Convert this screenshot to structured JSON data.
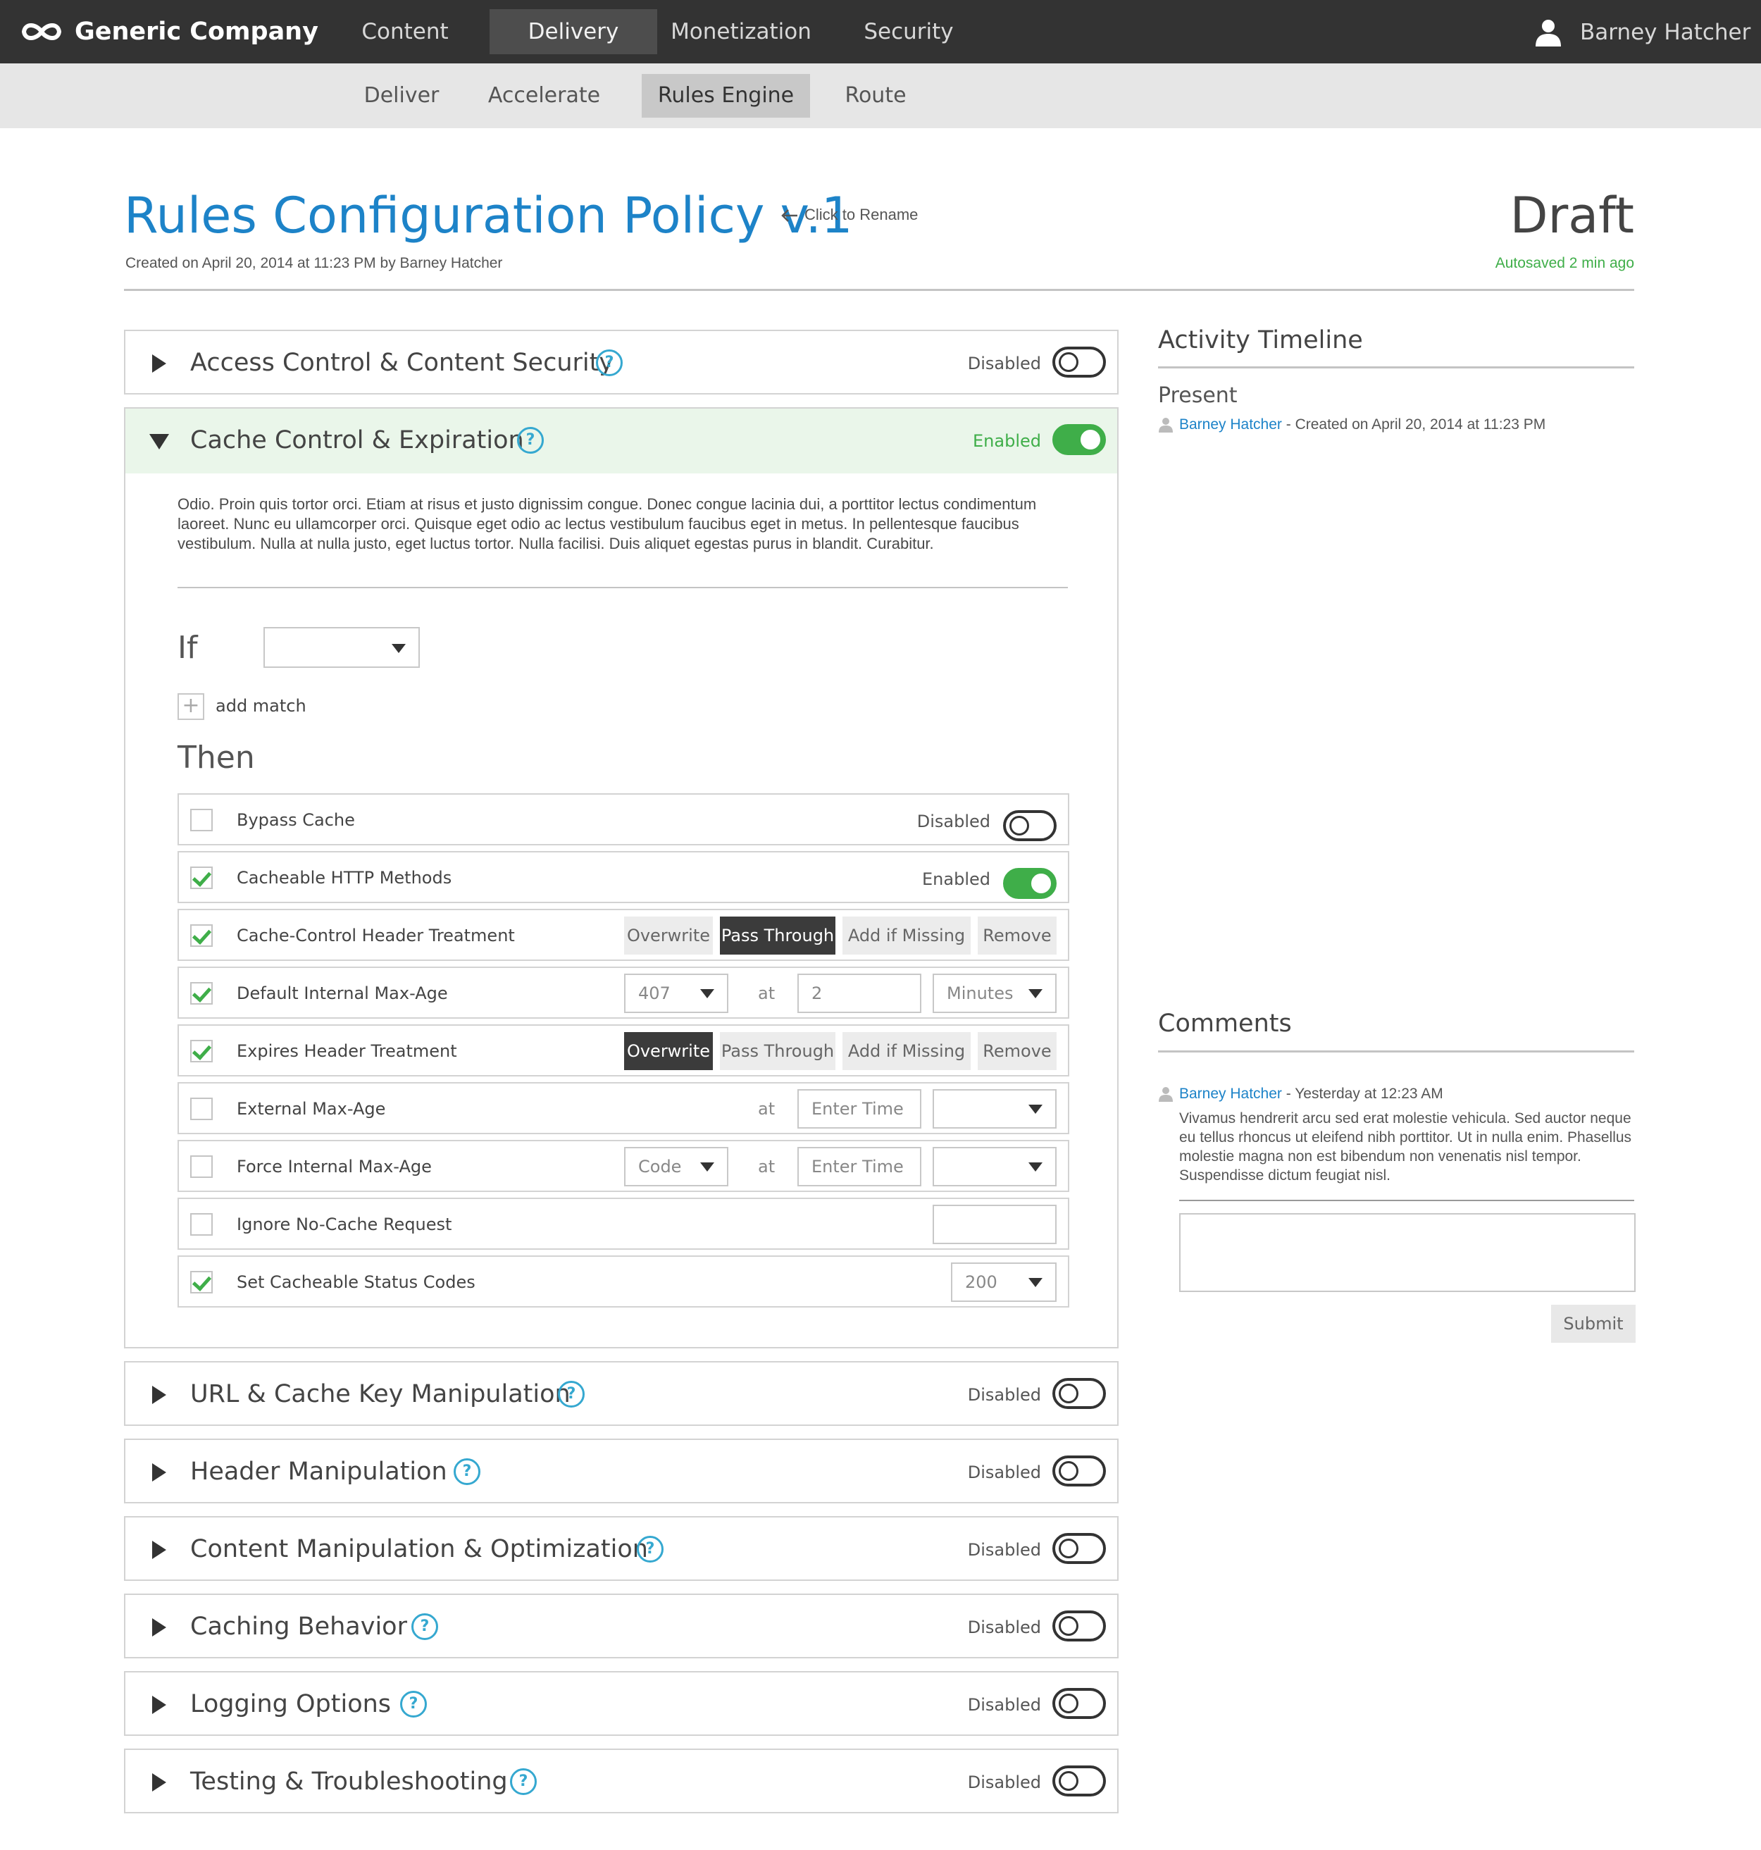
{
  "app": {
    "brand": "Generic Company",
    "logo_icon": "infinity-icon",
    "user_name": "Barney Hatcher",
    "user_icon": "user-icon"
  },
  "top_nav": [
    {
      "label": "Content",
      "active": false
    },
    {
      "label": "Delivery",
      "active": true
    },
    {
      "label": "Monetization",
      "active": false
    },
    {
      "label": "Security",
      "active": false
    }
  ],
  "sub_nav": [
    {
      "label": "Deliver",
      "active": false
    },
    {
      "label": "Accelerate",
      "active": false
    },
    {
      "label": "Rules Engine",
      "active": true
    },
    {
      "label": "Route",
      "active": false
    }
  ],
  "policy": {
    "title": "Rules Configuration Policy v.1",
    "rename_hint": "Click to Rename",
    "created": "Created on April 20, 2014 at 11:23 PM by Barney Hatcher",
    "status": "Draft",
    "autosaved": "Autosaved 2 min ago"
  },
  "sections": [
    {
      "title": "Access Control & Content Security",
      "state": "Disabled",
      "expanded": false
    },
    {
      "title": "Cache Control & Expiration",
      "state": "Enabled",
      "expanded": true
    },
    {
      "title": "URL & Cache Key Manipulation",
      "state": "Disabled",
      "expanded": false
    },
    {
      "title": "Header Manipulation",
      "state": "Disabled",
      "expanded": false
    },
    {
      "title": "Content Manipulation & Optimization",
      "state": "Disabled",
      "expanded": false
    },
    {
      "title": "Caching Behavior",
      "state": "Disabled",
      "expanded": false
    },
    {
      "title": "Logging Options",
      "state": "Disabled",
      "expanded": false
    },
    {
      "title": "Testing & Troubleshooting",
      "state": "Disabled",
      "expanded": false
    }
  ],
  "help_glyph": "?",
  "cache_section": {
    "description": "Odio. Proin quis tortor orci. Etiam at risus et justo dignissim congue. Donec congue lacinia dui, a porttitor lectus condimentum laoreet. Nunc eu ullamcorper orci. Quisque eget odio ac lectus vestibulum faucibus eget in metus. In pellentesque faucibus vestibulum. Nulla at nulla justo, eget luctus tortor. Nulla facilisi. Duis aliquet egestas purus in blandit. Curabitur.",
    "if_label": "If",
    "if_value": "",
    "add_match": "add match",
    "add_glyph": "+",
    "then_label": "Then",
    "at_label": "at",
    "rules": [
      {
        "label": "Bypass Cache",
        "checked": false,
        "state": "Disabled"
      },
      {
        "label": "Cacheable HTTP Methods",
        "checked": true,
        "state": "Enabled"
      },
      {
        "label": "Cache-Control Header Treatment",
        "checked": true,
        "options": [
          "Overwrite",
          "Pass Through",
          "Add if Missing",
          "Remove"
        ],
        "selected": "Pass Through"
      },
      {
        "label": "Default Internal Max-Age",
        "checked": true,
        "code": "407",
        "time": "2",
        "unit": "Minutes"
      },
      {
        "label": "Expires Header Treatment",
        "checked": true,
        "options": [
          "Overwrite",
          "Pass Through",
          "Add if Missing",
          "Remove"
        ],
        "selected": "Overwrite"
      },
      {
        "label": "External Max-Age",
        "checked": false,
        "time_placeholder": "Enter Time",
        "unit": ""
      },
      {
        "label": "Force Internal Max-Age",
        "checked": false,
        "code": "Code",
        "time_placeholder": "Enter Time",
        "unit": ""
      },
      {
        "label": "Ignore No-Cache Request",
        "checked": false,
        "value": ""
      },
      {
        "label": "Set Cacheable Status Codes",
        "checked": true,
        "value": "200"
      }
    ]
  },
  "activity": {
    "title": "Activity Timeline",
    "period": "Present",
    "entry_user": "Barney Hatcher",
    "entry_text": " - Created on April 20, 2014 at 11:23 PM"
  },
  "comments": {
    "title": "Comments",
    "user": "Barney Hatcher",
    "time": " - Yesterday at 12:23 AM",
    "body": "Vivamus hendrerit arcu sed erat molestie vehicula. Sed auctor neque eu tellus rhoncus ut eleifend nibh porttitor. Ut in nulla enim. Phasellus molestie magna non est bibendum non venenatis nisl tempor. Suspendisse dictum feugiat nisl.",
    "input_value": "",
    "submit": "Submit"
  },
  "colors": {
    "topbar": "#333333",
    "subbar": "#e6e6e6",
    "title_blue": "#1d83c8",
    "enabled_green": "#3fae49",
    "help_blue": "#35a8d0",
    "selected_segment": "#3b3b3b"
  }
}
